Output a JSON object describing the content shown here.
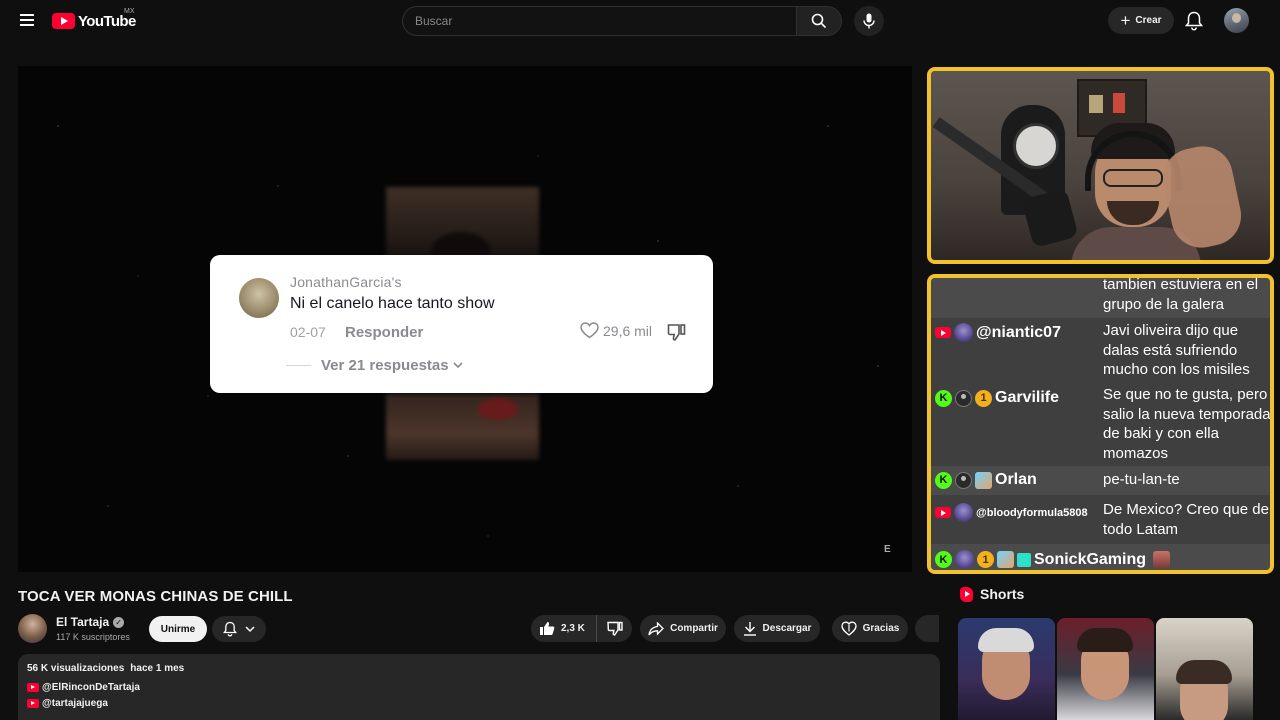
{
  "topbar": {
    "logo_text": "YouTube",
    "country_code": "MX",
    "search_placeholder": "Buscar",
    "create_label": "Crear"
  },
  "video_overlay": {
    "comment": {
      "username": "JonathanGarcia's",
      "text": "Ni el canelo hace tanto show",
      "date": "02-07",
      "reply_label": "Responder",
      "likes": "29,6 mil",
      "replies_label": "Ver 21 respuestas"
    },
    "watermark": "E"
  },
  "chat": {
    "partial_message": "tambien estuviera en el grupo de la galera",
    "messages": [
      {
        "platform": "youtube",
        "name": "@niantic07",
        "text": "Javi oliveira dijo que dalas está sufriendo mucho con los misiles"
      },
      {
        "platform": "kick",
        "coin": "1",
        "name": "Garvilife",
        "text": "Se que no te gusta, pero salio la nueva temporada de baki y con ella momazos"
      },
      {
        "platform": "kick",
        "name": "Orlan",
        "text": "pe-tu-lan-te"
      },
      {
        "platform": "youtube",
        "name": "@bloodyformula5808",
        "text": "De Mexico? Creo que de todo Latam"
      },
      {
        "platform": "kick",
        "coin": "1",
        "name": "SonickGaming",
        "text": ""
      }
    ]
  },
  "video": {
    "title": "TOCA VER MONAS CHINAS DE CHILL",
    "channel": "El Tartaja",
    "subscribers": "117 K suscriptores",
    "join_label": "Unirme",
    "likes": "2,3 K",
    "share_label": "Compartir",
    "download_label": "Descargar",
    "thanks_label": "Gracias"
  },
  "description": {
    "views": "56 K visualizaciones",
    "date": "hace 1 mes",
    "links": [
      "@ElRinconDeTartaja",
      "@tartajajuega"
    ]
  },
  "shorts": {
    "heading": "Shorts"
  },
  "colors": {
    "background": "#0f0f0f",
    "youtube_red": "#ff0033",
    "overlay_border": "#f2c12e",
    "kick_green": "#53fc18"
  }
}
